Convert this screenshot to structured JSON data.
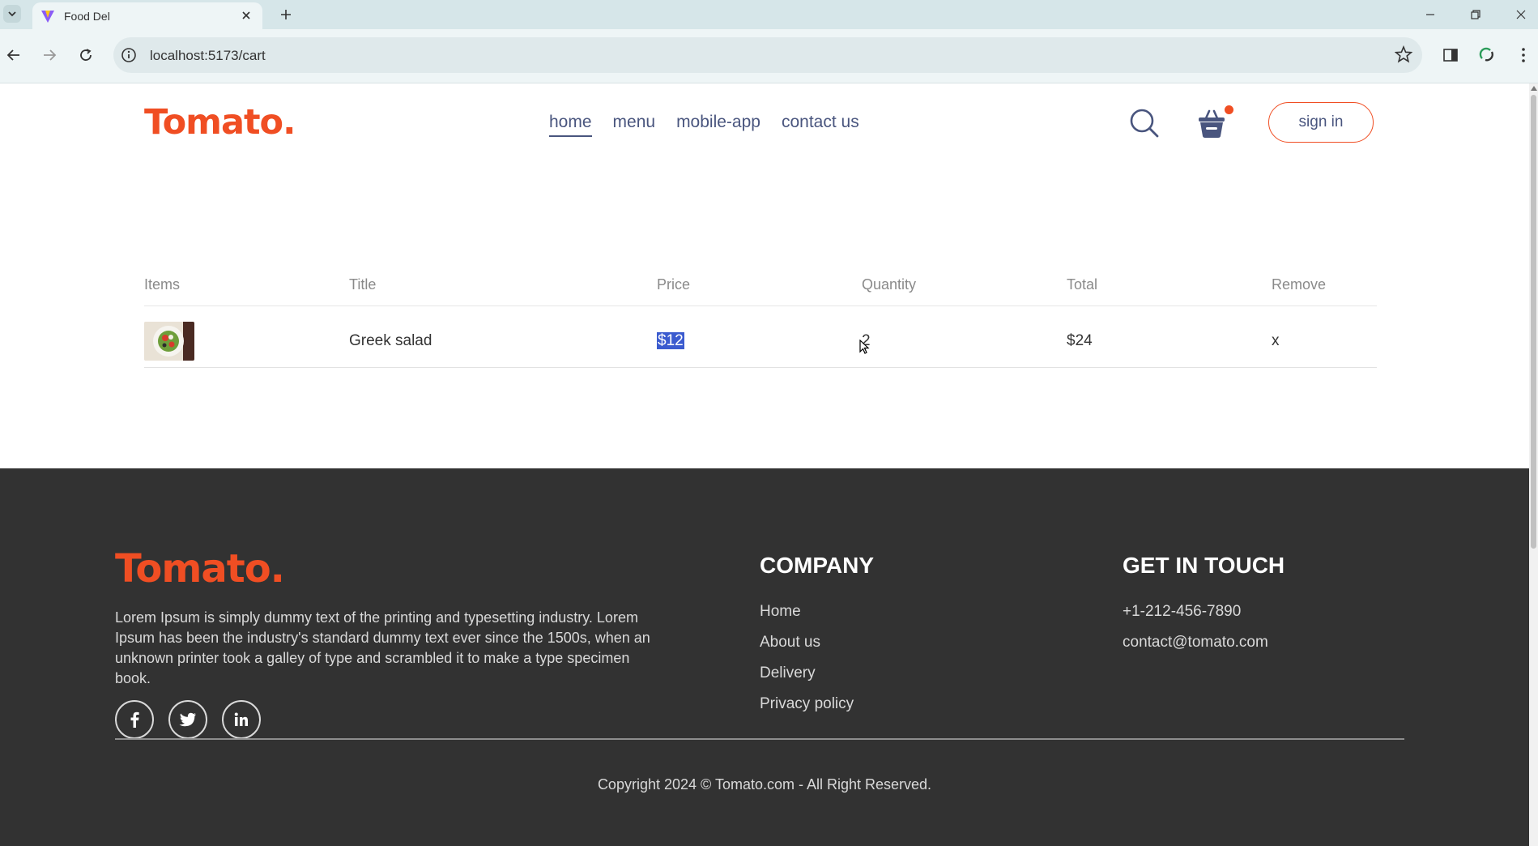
{
  "browser": {
    "tab_title": "Food Del",
    "url": "localhost:5173/cart"
  },
  "header": {
    "logo": "Tomato.",
    "menu": [
      {
        "label": "home",
        "active": true
      },
      {
        "label": "menu",
        "active": false
      },
      {
        "label": "mobile-app",
        "active": false
      },
      {
        "label": "contact us",
        "active": false
      }
    ],
    "signin_label": "sign in",
    "accent_color": "#f04e23",
    "nav_text_color": "#49557e"
  },
  "cart": {
    "headers": [
      "Items",
      "Title",
      "Price",
      "Quantity",
      "Total",
      "Remove"
    ],
    "rows": [
      {
        "image": "greek-salad-image",
        "title": "Greek salad",
        "price": "$12",
        "quantity": "2",
        "total": "$24",
        "remove": "x"
      }
    ]
  },
  "footer": {
    "logo": "Tomato.",
    "description": "Lorem Ipsum is simply dummy text of the printing and typesetting industry. Lorem Ipsum has been the industry's standard dummy text ever since the 1500s, when an unknown printer took a galley of type and scrambled it to make a type specimen book.",
    "social": [
      "facebook-icon",
      "twitter-icon",
      "linkedin-icon"
    ],
    "company_title": "COMPANY",
    "company_links": [
      "Home",
      "About us",
      "Delivery",
      "Privacy policy"
    ],
    "contact_title": "GET IN TOUCH",
    "contact": [
      "+1-212-456-7890",
      "contact@tomato.com"
    ],
    "copyright": "Copyright 2024 © Tomato.com - All Right Reserved."
  }
}
